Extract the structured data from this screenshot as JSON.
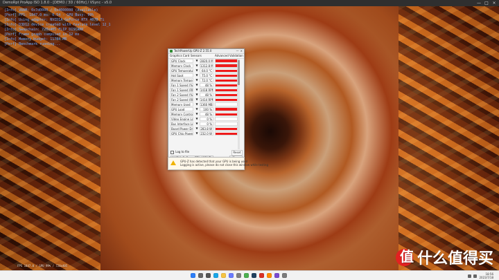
{
  "topbar": {
    "title": "DemoRpt ProApp ISO 1.8.0 - [DEMO / 3D / 60Hz] / VSync - v5.0"
  },
  "console": [
    "[Info] VRAM: 0x7d0000 / 0x4000000 (Available)",
    "[Perf] FPS: 1847.0 ms: 0.54 - GPU Busy: 99%",
    "[Info] Using adapter: NVIDIA GeForce RTX 4070 Ti",
    "[Info] D3D12 device created with feature level 12_1",
    "[Info] Swapchain: 720x405 FLIP_DISCARD",
    "[Perf] Frame graph compiled in 12 ms",
    "[Info] Memory budget: 11784 MB",
    "[Perf] Benchmark running..."
  ],
  "window": {
    "title": "TechPowerUp GPU-Z 2.55.0",
    "subbar_left": "Graphics Card",
    "subbar_mid": "Sensors",
    "subbar_right": "Advanced  Validation",
    "sensors": [
      {
        "label": "GPU Clock",
        "value": "2820.0 MHz",
        "level": 0.92
      },
      {
        "label": "Memory Clock",
        "value": "1312.8 MHz",
        "level": 0.9
      },
      {
        "label": "GPU Temperature",
        "value": "64.0 °C",
        "level": 0.74
      },
      {
        "label": "Hot Spot",
        "value": "75.0 °C",
        "level": 0.74
      },
      {
        "label": "Memory Temperature",
        "value": "72.0 °C",
        "level": 0.72
      },
      {
        "label": "Fan 1 Speed (%)",
        "value": "48 %",
        "level": 0.65
      },
      {
        "label": "Fan 1 Speed (RPM)",
        "value": "1418 RPM",
        "level": 0.64
      },
      {
        "label": "Fan 2 Speed (%)",
        "value": "48 %",
        "level": 0.64
      },
      {
        "label": "Fan 2 Speed (RPM)",
        "value": "1414 RPM",
        "level": 0.63
      },
      {
        "label": "Memory Used",
        "value": "1360 MB",
        "level": 0.1
      },
      {
        "label": "GPU Load",
        "value": "100 %",
        "level": 1.0
      },
      {
        "label": "Memory Controller Load",
        "value": "48 %",
        "level": 0.66
      },
      {
        "label": "Video Engine Load",
        "value": "0 %",
        "level": 0.0
      },
      {
        "label": "Bus Interface Load",
        "value": "0 %",
        "level": 0.0
      },
      {
        "label": "Board Power Draw",
        "value": "283.8 W",
        "level": 0.86
      },
      {
        "label": "GPU Chip Power Draw",
        "value": "232.0 W",
        "level": 0.86
      }
    ],
    "log_label": "Log to file",
    "reset_label": "Reset",
    "gpu_selected": "NVIDIA GeForce RTX 4070 Ti",
    "close_label": "Close"
  },
  "notification": {
    "line1": "GPU-Z has detected that your GPU is being used",
    "line2": "Logging is active, please do not close this window while testing"
  },
  "bottom_status": "FPS 1847.0 / GPU 99% / 720x405",
  "watermark": {
    "logo_text": "值",
    "text": "什么值得买"
  },
  "taskbar": {
    "icons": [
      {
        "name": "windows-icon",
        "color": "#2d7ff9"
      },
      {
        "name": "search-icon",
        "color": "#666666"
      },
      {
        "name": "task-view-icon",
        "color": "#555555"
      },
      {
        "name": "edge-icon",
        "color": "#1aa7e8"
      },
      {
        "name": "folder-icon",
        "color": "#f6c443"
      },
      {
        "name": "store-icon",
        "color": "#6a7cff"
      },
      {
        "name": "settings-icon",
        "color": "#808080"
      },
      {
        "name": "chrome-icon",
        "color": "#4caf50"
      },
      {
        "name": "steam-icon",
        "color": "#20405e"
      },
      {
        "name": "app-red-icon",
        "color": "#d93025"
      },
      {
        "name": "app-orange-icon",
        "color": "#ff8c00"
      },
      {
        "name": "app-purple-icon",
        "color": "#7b4bd1"
      },
      {
        "name": "app-gray-icon",
        "color": "#7b7b7b"
      }
    ],
    "tray_time": "18:56",
    "tray_date": "2023/7/18"
  }
}
